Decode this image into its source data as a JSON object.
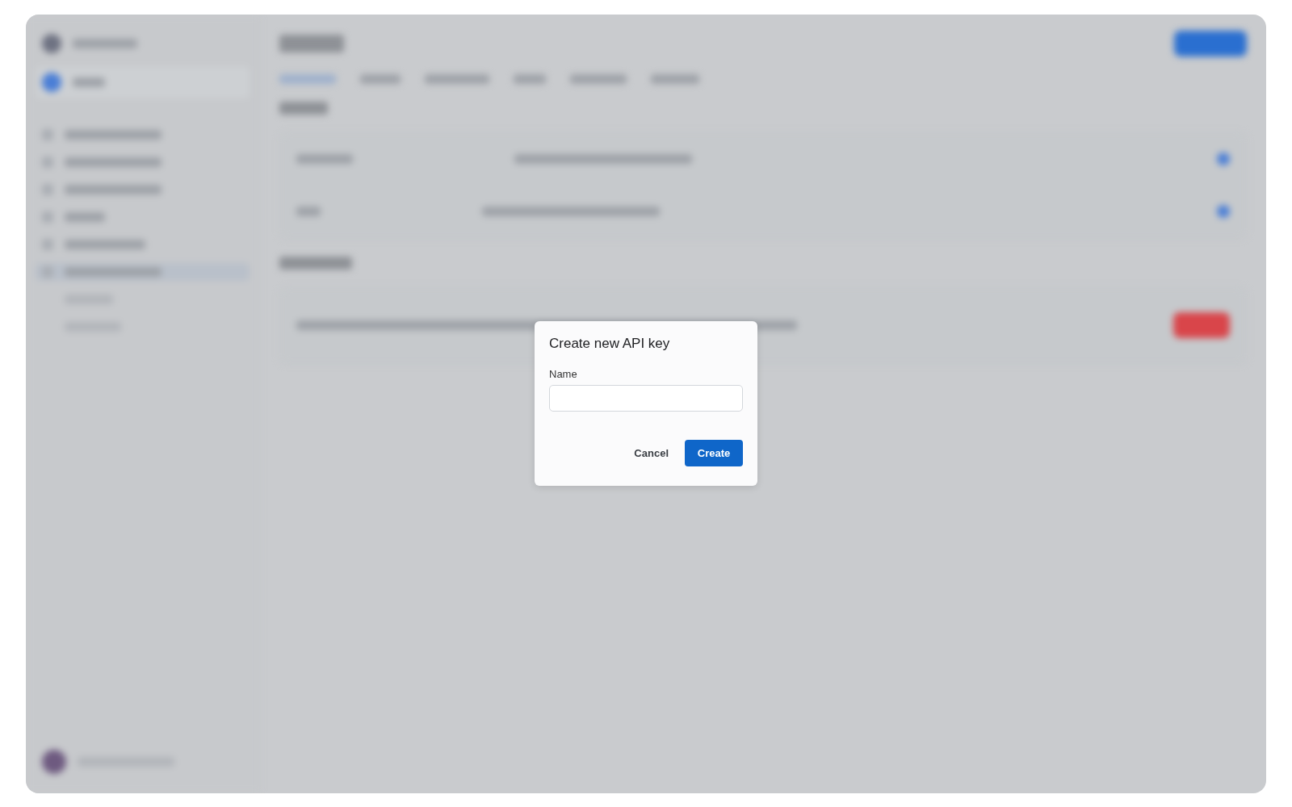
{
  "dialog": {
    "title": "Create new API key",
    "field": {
      "label": "Name"
    },
    "buttons": [
      {
        "label": "Cancel",
        "kind": "secondary"
      },
      {
        "label": "Create",
        "kind": "primary"
      }
    ]
  }
}
